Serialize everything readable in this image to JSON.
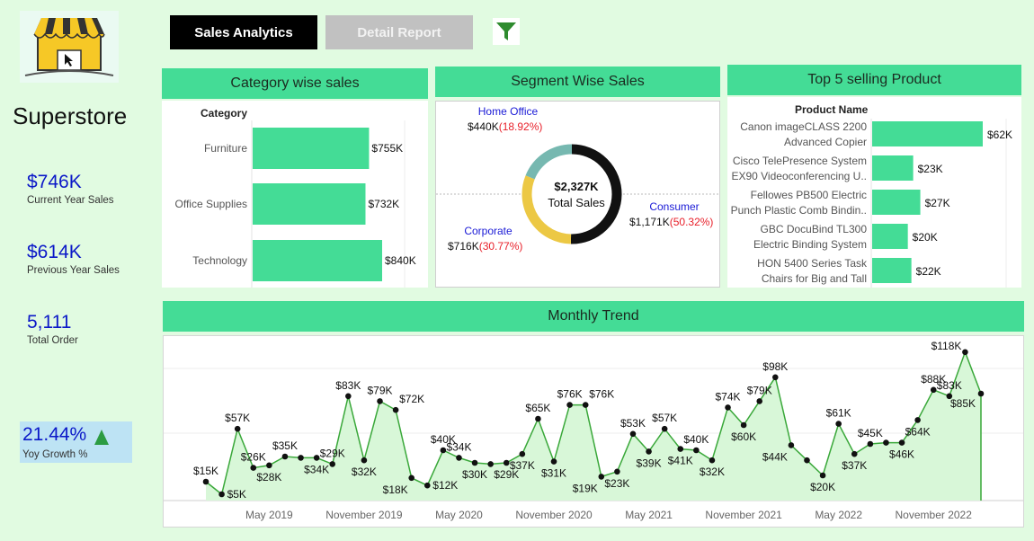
{
  "app": {
    "title": "Superstore"
  },
  "tabs": {
    "sales_analytics": "Sales Analytics",
    "detail_report": "Detail Report"
  },
  "toolbar": {
    "filter_icon": "filter-icon"
  },
  "kpis": {
    "current_year": {
      "value": "$746K",
      "label": "Current Year Sales"
    },
    "previous_year": {
      "value": "$614K",
      "label": "Previous Year Sales"
    },
    "total_order": {
      "value": "5,111",
      "label": "Total Order"
    },
    "yoy_growth": {
      "value": "21.44%",
      "label": "Yoy Growth %",
      "direction_icon": "up-triangle-icon"
    }
  },
  "colors": {
    "accent": "#44dc96",
    "kpi_blue": "#0b18c8",
    "negative_red": "#e8202a",
    "background": "#e1fbe1"
  },
  "panels": {
    "category": "Category wise sales",
    "segment": "Segment Wise Sales",
    "top5": "Top 5 selling Product",
    "trend": "Monthly Trend"
  },
  "chart_data": [
    {
      "id": "category",
      "type": "bar",
      "orientation": "horizontal",
      "header_label": "Category",
      "categories": [
        "Furniture",
        "Office Supplies",
        "Technology"
      ],
      "values": [
        755,
        732,
        840
      ],
      "labels": [
        "$755K",
        "$732K",
        "$840K"
      ],
      "unit": "K USD"
    },
    {
      "id": "segment",
      "type": "pie",
      "style": "donut",
      "center_value": "$2,327K",
      "center_label": "Total Sales",
      "slices": [
        {
          "name": "Home Office",
          "value": 440,
          "value_label": "$440K",
          "pct": "(18.92%)",
          "color": "#76b8b0"
        },
        {
          "name": "Consumer",
          "value": 1171,
          "value_label": "$1,171K",
          "pct": "(50.32%)",
          "color": "#111111"
        },
        {
          "name": "Corporate",
          "value": 716,
          "value_label": "$716K",
          "pct": "(30.77%)",
          "color": "#ecc844"
        }
      ]
    },
    {
      "id": "top5",
      "type": "bar",
      "orientation": "horizontal",
      "header_label": "Product Name",
      "categories": [
        [
          "Canon imageCLASS 2200",
          "Advanced Copier"
        ],
        [
          "Cisco TelePresence System",
          "EX90 Videoconferencing U.."
        ],
        [
          "Fellowes PB500 Electric",
          "Punch Plastic Comb Bindin.."
        ],
        [
          "GBC DocuBind TL300",
          "Electric Binding System"
        ],
        [
          "HON 5400 Series Task",
          "Chairs for Big and Tall"
        ]
      ],
      "values": [
        62,
        23,
        27,
        20,
        22
      ],
      "labels": [
        "$62K",
        "$23K",
        "$27K",
        "$20K",
        "$22K"
      ],
      "unit": "K USD"
    },
    {
      "id": "trend",
      "type": "area",
      "x_tick_labels": [
        "May 2019",
        "November 2019",
        "May 2020",
        "November 2020",
        "May 2021",
        "November 2021",
        "May 2022",
        "November 2022"
      ],
      "x_tick_indices": [
        4,
        10,
        16,
        22,
        28,
        34,
        40,
        46
      ],
      "ylim": [
        0,
        125
      ],
      "unit": "K USD",
      "values": [
        15,
        5,
        57,
        26,
        28,
        35,
        34,
        34,
        29,
        83,
        32,
        79,
        72,
        18,
        12,
        40,
        34,
        30,
        29,
        30,
        37,
        65,
        31,
        76,
        76,
        19,
        23,
        53,
        39,
        57,
        41,
        40,
        32,
        74,
        60,
        79,
        98,
        44,
        32,
        20,
        61,
        37,
        45,
        46,
        46,
        64,
        88,
        83,
        118,
        85
      ],
      "labels": [
        {
          "i": 0,
          "text": "$15K",
          "pos": "above"
        },
        {
          "i": 1,
          "text": "$5K",
          "pos": "right"
        },
        {
          "i": 2,
          "text": "$57K",
          "pos": "above"
        },
        {
          "i": 3,
          "text": "$26K",
          "pos": "above"
        },
        {
          "i": 4,
          "text": "$28K",
          "pos": "below"
        },
        {
          "i": 5,
          "text": "$35K",
          "pos": "above"
        },
        {
          "i": 7,
          "text": "$34K",
          "pos": "below"
        },
        {
          "i": 8,
          "text": "$29K",
          "pos": "above"
        },
        {
          "i": 9,
          "text": "$83K",
          "pos": "above"
        },
        {
          "i": 10,
          "text": "$32K",
          "pos": "below"
        },
        {
          "i": 11,
          "text": "$79K",
          "pos": "above"
        },
        {
          "i": 12,
          "text": "$72K",
          "pos": "aboveright"
        },
        {
          "i": 13,
          "text": "$18K",
          "pos": "belowleft"
        },
        {
          "i": 14,
          "text": "$12K",
          "pos": "right"
        },
        {
          "i": 15,
          "text": "$40K",
          "pos": "above"
        },
        {
          "i": 16,
          "text": "$34K",
          "pos": "above"
        },
        {
          "i": 17,
          "text": "$30K",
          "pos": "below"
        },
        {
          "i": 19,
          "text": "$29K",
          "pos": "below"
        },
        {
          "i": 20,
          "text": "$37K",
          "pos": "below"
        },
        {
          "i": 21,
          "text": "$65K",
          "pos": "above"
        },
        {
          "i": 22,
          "text": "$31K",
          "pos": "below"
        },
        {
          "i": 23,
          "text": "$76K",
          "pos": "above"
        },
        {
          "i": 24,
          "text": "$76K",
          "pos": "aboveright"
        },
        {
          "i": 25,
          "text": "$19K",
          "pos": "belowleft"
        },
        {
          "i": 26,
          "text": "$23K",
          "pos": "below"
        },
        {
          "i": 27,
          "text": "$53K",
          "pos": "above"
        },
        {
          "i": 28,
          "text": "$39K",
          "pos": "below"
        },
        {
          "i": 29,
          "text": "$57K",
          "pos": "above"
        },
        {
          "i": 30,
          "text": "$41K",
          "pos": "below"
        },
        {
          "i": 31,
          "text": "$40K",
          "pos": "above"
        },
        {
          "i": 32,
          "text": "$32K",
          "pos": "below"
        },
        {
          "i": 33,
          "text": "$74K",
          "pos": "above"
        },
        {
          "i": 34,
          "text": "$60K",
          "pos": "below"
        },
        {
          "i": 35,
          "text": "$79K",
          "pos": "above"
        },
        {
          "i": 36,
          "text": "$98K",
          "pos": "above"
        },
        {
          "i": 37,
          "text": "$44K",
          "pos": "belowleft"
        },
        {
          "i": 39,
          "text": "$20K",
          "pos": "below"
        },
        {
          "i": 40,
          "text": "$61K",
          "pos": "above"
        },
        {
          "i": 41,
          "text": "$37K",
          "pos": "below"
        },
        {
          "i": 42,
          "text": "$45K",
          "pos": "above"
        },
        {
          "i": 44,
          "text": "$46K",
          "pos": "below"
        },
        {
          "i": 45,
          "text": "$64K",
          "pos": "below"
        },
        {
          "i": 46,
          "text": "$88K",
          "pos": "above"
        },
        {
          "i": 47,
          "text": "$83K",
          "pos": "above"
        },
        {
          "i": 48,
          "text": "$118K",
          "pos": "aboveleft"
        },
        {
          "i": 49,
          "text": "$85K",
          "pos": "left"
        }
      ]
    }
  ]
}
